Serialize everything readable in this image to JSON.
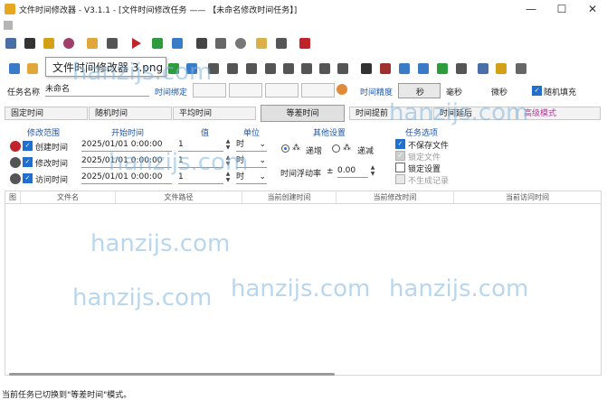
{
  "title": "文件时间修改器 - V3.1.1 - [文件时间修改任务 —— 【未命名修改时间任务】]",
  "window_buttons": {
    "minimize": "—",
    "maximize": "☐",
    "close": "✕"
  },
  "tooltip": "文件时间修改器 3.png",
  "task": {
    "name_label": "任务名称",
    "name_value": "未命名",
    "time_bind_label": "时间绑定",
    "precision_label": "时间精度",
    "precision_value": "秒",
    "precision_opt1": "毫秒",
    "precision_opt2": "微秒",
    "random_fill_label": "随机填充"
  },
  "mode_tabs": [
    "固定时间",
    "随机时间",
    "平均时间",
    "等差时间",
    "时间提前",
    "时间延后",
    "高级模式"
  ],
  "active_mode": "等差时间",
  "section_labels": {
    "range": "修改范围",
    "start": "开始时间",
    "value": "值",
    "unit": "单位",
    "other": "其他设置",
    "options": "任务选项"
  },
  "rows": [
    {
      "label": "创建时间",
      "start": "2025/01/01 0:00:00",
      "value": "1",
      "unit": "时"
    },
    {
      "label": "修改时间",
      "start": "2025/01/01 0:00:00",
      "value": "1",
      "unit": "时"
    },
    {
      "label": "访问时间",
      "start": "2025/01/01 0:00:00",
      "value": "1",
      "unit": "时"
    }
  ],
  "other": {
    "increasing": "递增",
    "decreasing": "递减",
    "float_label": "时间浮动率",
    "float_sign": "±",
    "float_value": "0.00"
  },
  "options": [
    {
      "label": "不保存文件",
      "state": "checked"
    },
    {
      "label": "锁定文件",
      "state": "disabled"
    },
    {
      "label": "锁定设置",
      "state": "unchecked"
    },
    {
      "label": "不生成记录",
      "state": "disabled"
    }
  ],
  "columns": [
    "图",
    "文件名",
    "文件路径",
    "当前创建时间",
    "当前修改时间",
    "当前访问时间"
  ],
  "watermarks": [
    "hanzijs.com",
    "hanzijs.com",
    "hanzijs.com",
    "hanzijs.com",
    "hanzijs.com",
    "hanzijs.com",
    "hanzijs.com"
  ],
  "status_text": "当前任务已切换到\"等差时间\"模式。",
  "colors": {
    "accent": "#1f6fd1",
    "label_blue": "#1f55a8",
    "advanced_tab": "#b0399a"
  }
}
